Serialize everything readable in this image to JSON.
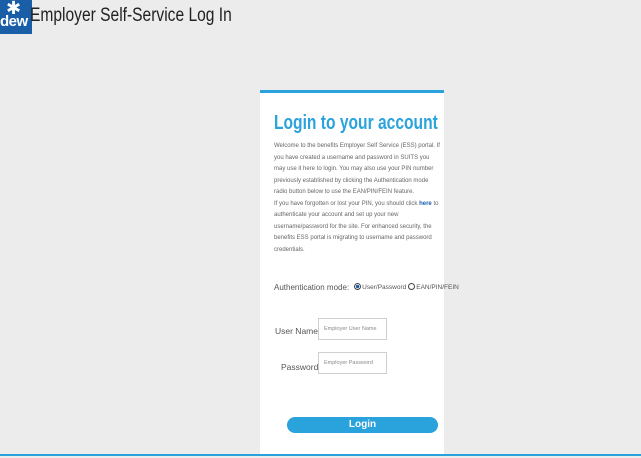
{
  "header": {
    "logo_text": "dew",
    "title": "Employer Self-Service Log In"
  },
  "login": {
    "title": "Login to your account",
    "intro_p1": "Welcome to the benefits Employer Self Service (ESS) portal. If you have created a username and password in SUITS you may use it here to login. You may also use your PIN number previously established by clicking the Authentication mode radio button below to use the EAN/PIN/FEIN feature.",
    "intro_p2a": "If you have forgotten or lost your PIN, you should click",
    "intro_link": "here",
    "intro_p2b": "to authenticate your account and set up your new username/password for the site. For enhanced security, the benefits ESS portal is migrating to username and password credentials.",
    "auth_label": "Authentication mode:",
    "auth_options": [
      {
        "label": "User/Password",
        "selected": true
      },
      {
        "label": "EAN/PIN/FEIN",
        "selected": false
      }
    ],
    "username_label": "User Name:",
    "username_placeholder": "Employer User Name",
    "username_value": "",
    "password_label": "Password:",
    "password_placeholder": "Employer Password",
    "password_value": "",
    "login_button": "Login"
  },
  "colors": {
    "accent": "#2aa2dc",
    "brand": "#1a5ea8",
    "background": "#ececec"
  }
}
